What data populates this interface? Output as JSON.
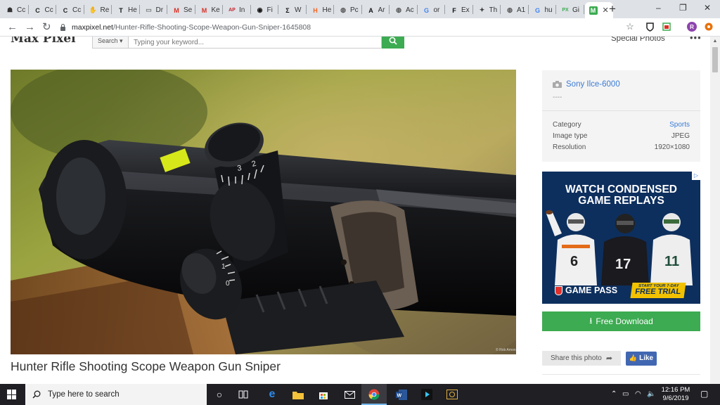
{
  "browser": {
    "tabs": [
      {
        "label": "Cc",
        "icon": "hat-icon",
        "color": "#333333",
        "glyph": "☗"
      },
      {
        "label": "Cc",
        "icon": "c-icon",
        "color": "#222222",
        "glyph": "C"
      },
      {
        "label": "Cc",
        "icon": "c-icon",
        "color": "#222222",
        "glyph": "C"
      },
      {
        "label": "Re",
        "icon": "hand-icon",
        "color": "#c08a2e",
        "glyph": "✋"
      },
      {
        "label": "He",
        "icon": "nyt-icon",
        "color": "#111111",
        "glyph": "T"
      },
      {
        "label": "Dr",
        "icon": "drive-icon",
        "color": "#777777",
        "glyph": "▭"
      },
      {
        "label": "Se",
        "icon": "gmail-icon",
        "color": "#d93025",
        "glyph": "M"
      },
      {
        "label": "Ke",
        "icon": "gmail-icon",
        "color": "#d93025",
        "glyph": "M"
      },
      {
        "label": "In",
        "icon": "ap-icon",
        "color": "#c4262e",
        "glyph": "AP"
      },
      {
        "label": "Fi",
        "icon": "record-icon",
        "color": "#111111",
        "glyph": "◉"
      },
      {
        "label": "W",
        "icon": "sigma-icon",
        "color": "#111111",
        "glyph": "Σ"
      },
      {
        "label": "He",
        "icon": "hacker-icon",
        "color": "#f26522",
        "glyph": "H"
      },
      {
        "label": "Pc",
        "icon": "globe-icon",
        "color": "#555555",
        "glyph": "◍"
      },
      {
        "label": "Ar",
        "icon": "a-icon",
        "color": "#111111",
        "glyph": "A"
      },
      {
        "label": "Ac",
        "icon": "globe-icon",
        "color": "#555555",
        "glyph": "◍"
      },
      {
        "label": "or",
        "icon": "google-icon",
        "color": "#4285f4",
        "glyph": "G"
      },
      {
        "label": "Ex",
        "icon": "f-icon",
        "color": "#111111",
        "glyph": "F"
      },
      {
        "label": "Th",
        "icon": "star-icon",
        "color": "#444444",
        "glyph": "✦"
      },
      {
        "label": "A1",
        "icon": "globe-icon",
        "color": "#555555",
        "glyph": "◍"
      },
      {
        "label": "hu",
        "icon": "google-icon",
        "color": "#4285f4",
        "glyph": "G"
      },
      {
        "label": "Gi",
        "icon": "px-icon",
        "color": "#3cab51",
        "glyph": "PX"
      }
    ],
    "active_tab": {
      "label": "M",
      "icon": "maxpixel-icon",
      "color": "#3cab51"
    },
    "url_host": "maxpixel.net",
    "url_path": "/Hunter-Rifle-Shooting-Scope-Weapon-Gun-Sniper-1645808",
    "profile_initial": "R"
  },
  "site": {
    "logo": "Max Pixel",
    "search_dropdown": "Search",
    "search_placeholder": "Typing your keyword...",
    "special_photos": "Special Photos",
    "more_glyph": "•••"
  },
  "photo": {
    "title": "Hunter Rifle Shooting Scope Weapon Gun Sniper",
    "dial_numbers": [
      "3",
      "2",
      "1",
      "0"
    ],
    "watermark": "© Rob Arnon"
  },
  "sidebar": {
    "camera": "Sony Ilce-6000",
    "camera_sub": "----",
    "info": [
      {
        "label": "Category",
        "value": "Sports",
        "link": true
      },
      {
        "label": "Image type",
        "value": "JPEG",
        "link": false
      },
      {
        "label": "Resolution",
        "value": "1920×1080",
        "link": false
      }
    ],
    "ad": {
      "headline_1": "WATCH CONDENSED",
      "headline_2": "GAME REPLAYS",
      "brand": "GAME PASS",
      "promo_small": "START YOUR 7-DAY",
      "promo_big": "FREE TRIAL",
      "jersey_numbers": [
        "6",
        "17",
        "11"
      ],
      "badge": "▷"
    },
    "download_label": "Free Download",
    "share_label": "Share this photo",
    "like_label": "Like"
  },
  "taskbar": {
    "search_text": "Type here to search",
    "time": "12:16 PM",
    "date": "9/6/2019"
  }
}
